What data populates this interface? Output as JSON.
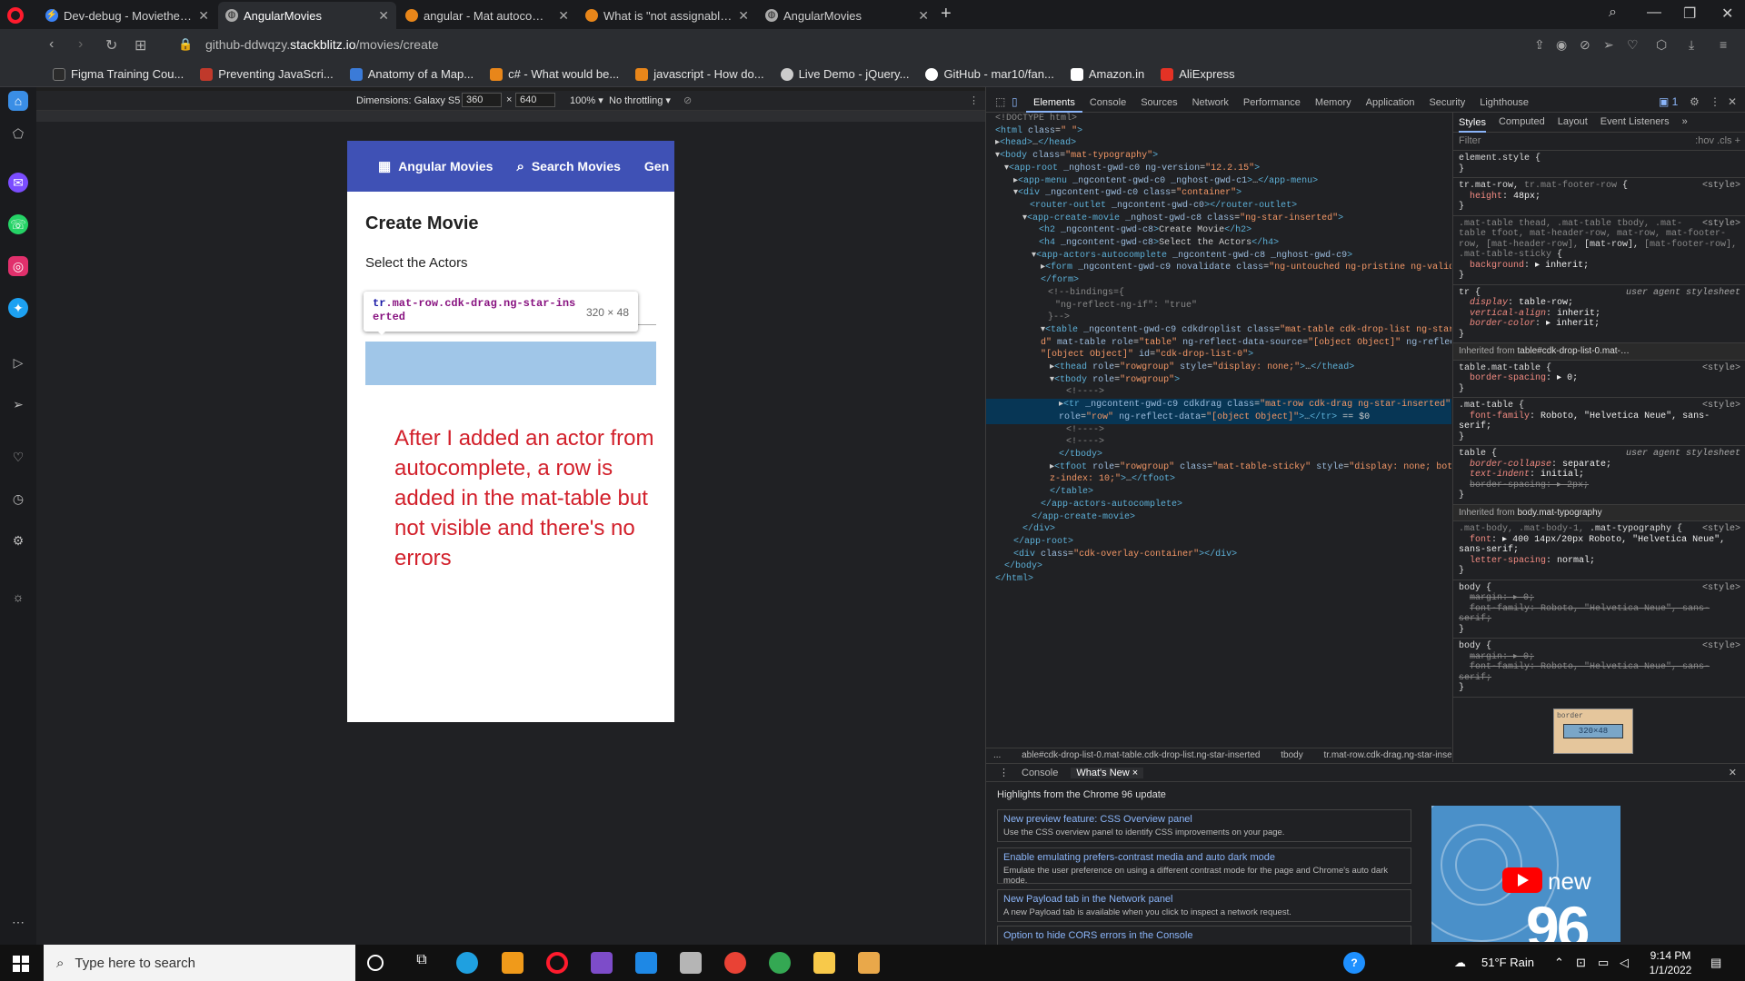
{
  "browser": {
    "tabs": [
      {
        "title": "Dev-debug - Movietheater",
        "active": false
      },
      {
        "title": "AngularMovies",
        "active": true
      },
      {
        "title": "angular - Mat autocomplete",
        "active": false
      },
      {
        "title": "What is \"not assignable to",
        "active": false
      },
      {
        "title": "AngularMovies",
        "active": false
      }
    ],
    "url_prefix": "github-ddwqzy.",
    "url_host": "stackblitz.io",
    "url_path": "/movies/create",
    "bookmarks": [
      {
        "label": "Figma Training Cou...",
        "color": "#2b2b2b"
      },
      {
        "label": "Preventing JavaScri...",
        "color": "#c0392b"
      },
      {
        "label": "Anatomy of a Map...",
        "color": "#3b7bd8"
      },
      {
        "label": "c# - What would be...",
        "color": "#e8861a"
      },
      {
        "label": "javascript - How do...",
        "color": "#e8861a"
      },
      {
        "label": "Live Demo - jQuery...",
        "color": "#cccccc"
      },
      {
        "label": "GitHub - mar10/fan...",
        "color": "#ffffff"
      },
      {
        "label": "Amazon.in",
        "color": "#ffffff"
      },
      {
        "label": "AliExpress",
        "color": "#e43225"
      }
    ]
  },
  "device_toolbar": {
    "dimensions_label": "Dimensions: Galaxy S5 ▾",
    "width": "360",
    "times": "×",
    "height": "640",
    "zoom": "100% ▾",
    "throttle": "No throttling ▾"
  },
  "app": {
    "nav": [
      {
        "icon": "film-icon",
        "glyph": "▦",
        "label": "Angular Movies"
      },
      {
        "icon": "search-icon",
        "glyph": "⌕",
        "label": "Search Movies"
      },
      {
        "icon": "",
        "glyph": "",
        "label": "Gen"
      }
    ],
    "page_title": "Create Movie",
    "subtitle": "Select the Actors",
    "tooltip_selector_tag": "tr",
    "tooltip_selector_rest": ".mat-row.cdk-drag.ng-star-inserted",
    "tooltip_dims": "320 × 48",
    "annotation": "After I added an actor from autocomplete, a row is added in the mat-table but not visible and there's no errors"
  },
  "devtools": {
    "tabs": [
      "Elements",
      "Console",
      "Sources",
      "Network",
      "Performance",
      "Memory",
      "Application",
      "Security",
      "Lighthouse"
    ],
    "active_tab": "Elements",
    "badge": "1",
    "style_tabs": [
      "Styles",
      "Computed",
      "Layout",
      "Event Listeners",
      "»"
    ],
    "filter_placeholder": "Filter",
    "filter_tools": ":hov  .cls  +",
    "breadcrumbs": [
      "...",
      "able#cdk-drop-list-0.mat-table.cdk-drop-list.ng-star-inserted",
      "tbody",
      "tr.mat-row.cdk-drag.ng-star-inserted",
      "..."
    ],
    "drawer_tabs": [
      "Console",
      "What's New ×"
    ],
    "whats_new_heading": "Highlights from the Chrome 96 update",
    "whats_new_items": [
      {
        "title": "New preview feature: CSS Overview panel",
        "desc": "Use the CSS overview panel to identify CSS improvements on your page."
      },
      {
        "title": "Enable emulating prefers-contrast media and auto dark mode",
        "desc": "Emulate the user preference on using a different contrast mode for the page and Chrome's auto dark mode."
      },
      {
        "title": "New Payload tab in the Network panel",
        "desc": "A new Payload tab is available when you click to inspect a network request."
      },
      {
        "title": "Option to hide CORS errors in the Console",
        "desc": ""
      }
    ],
    "video_new": "new",
    "video_num": "96",
    "box_model_label": "border",
    "box_model_dims": "320×48"
  },
  "taskbar": {
    "search_placeholder": "Type here to search",
    "weather": "51°F  Rain",
    "time": "9:14 PM",
    "date": "1/1/2022"
  }
}
